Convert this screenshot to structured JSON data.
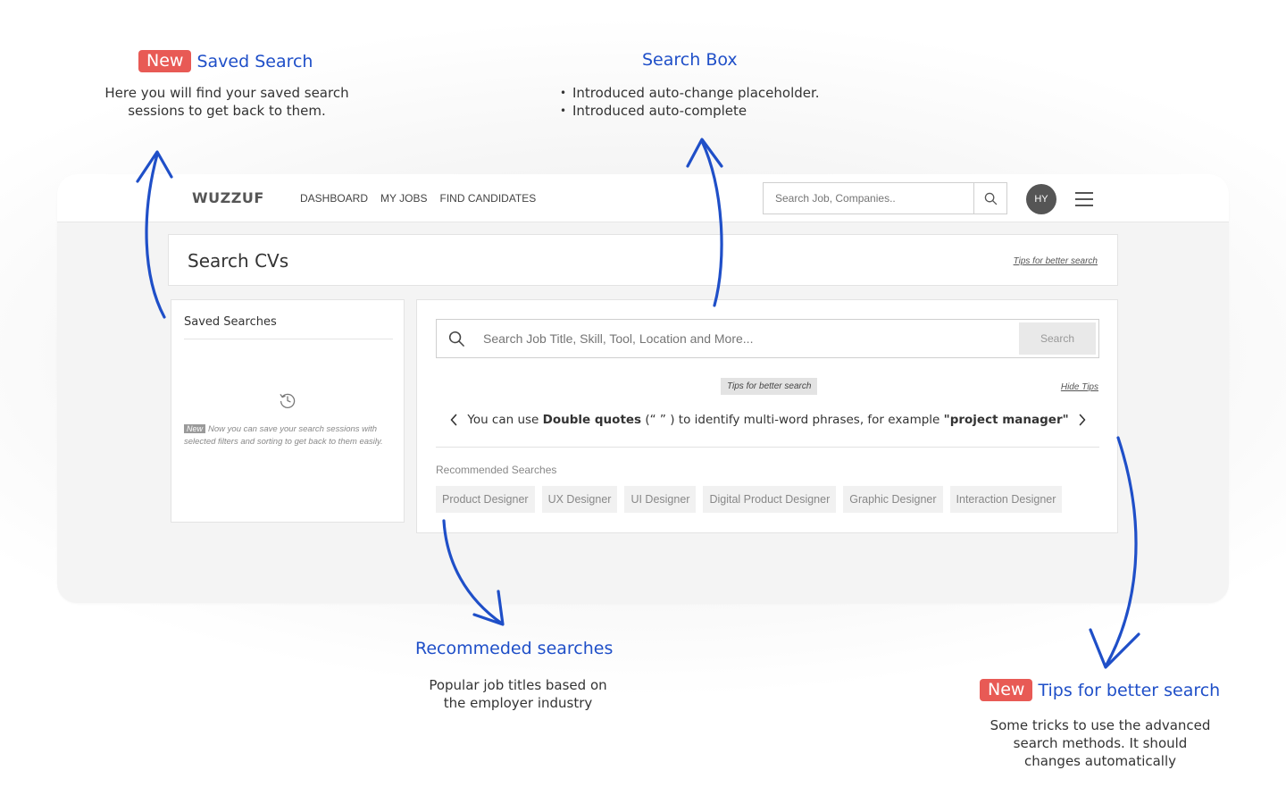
{
  "annotations": {
    "saved_search": {
      "badge": "New",
      "title": "Saved Search",
      "desc_line1": "Here you will find your saved search",
      "desc_line2": "sessions to get back to them."
    },
    "search_box": {
      "title": "Search Box",
      "bullets": [
        "Introduced auto-change placeholder.",
        "Introduced auto-complete"
      ]
    },
    "recommended": {
      "title": "Recommeded searches",
      "desc_line1": "Popular job titles based on",
      "desc_line2": "the employer industry"
    },
    "tips": {
      "badge": "New",
      "title": "Tips for better search",
      "desc_line1": "Some tricks to use the advanced",
      "desc_line2": "search methods. It should",
      "desc_line3": "changes automatically"
    }
  },
  "topbar": {
    "logo": "WUZZUF",
    "nav": [
      "DASHBOARD",
      "MY JOBS",
      "FIND CANDIDATES"
    ],
    "search_placeholder": "Search Job, Companies..",
    "avatar": "HY"
  },
  "header": {
    "title": "Search CVs",
    "tips_link": "Tips for better search"
  },
  "saved": {
    "title": "Saved Searches",
    "new_badge": "New",
    "note": "Now you can save your search sessions with selected filters and sorting to get back to them easily."
  },
  "main": {
    "search_placeholder": "Search Job Title, Skill, Tool, Location and More...",
    "search_button": "Search",
    "tips_pill": "Tips for better search",
    "hide_tips": "Hide Tips",
    "tip": {
      "p1": "You can use ",
      "b1": "Double quotes",
      "p2": "  (“ ” ) to identify multi-word phrases, for example ",
      "b2": "\"project manager\""
    },
    "recommended_label": "Recommended Searches",
    "chips": [
      "Product Designer",
      "UX Designer",
      "UI Designer",
      "Digital Product Designer",
      "Graphic Designer",
      "Interaction Designer"
    ]
  },
  "colors": {
    "accent": "#1f4fc8",
    "badge": "#e85a55"
  }
}
